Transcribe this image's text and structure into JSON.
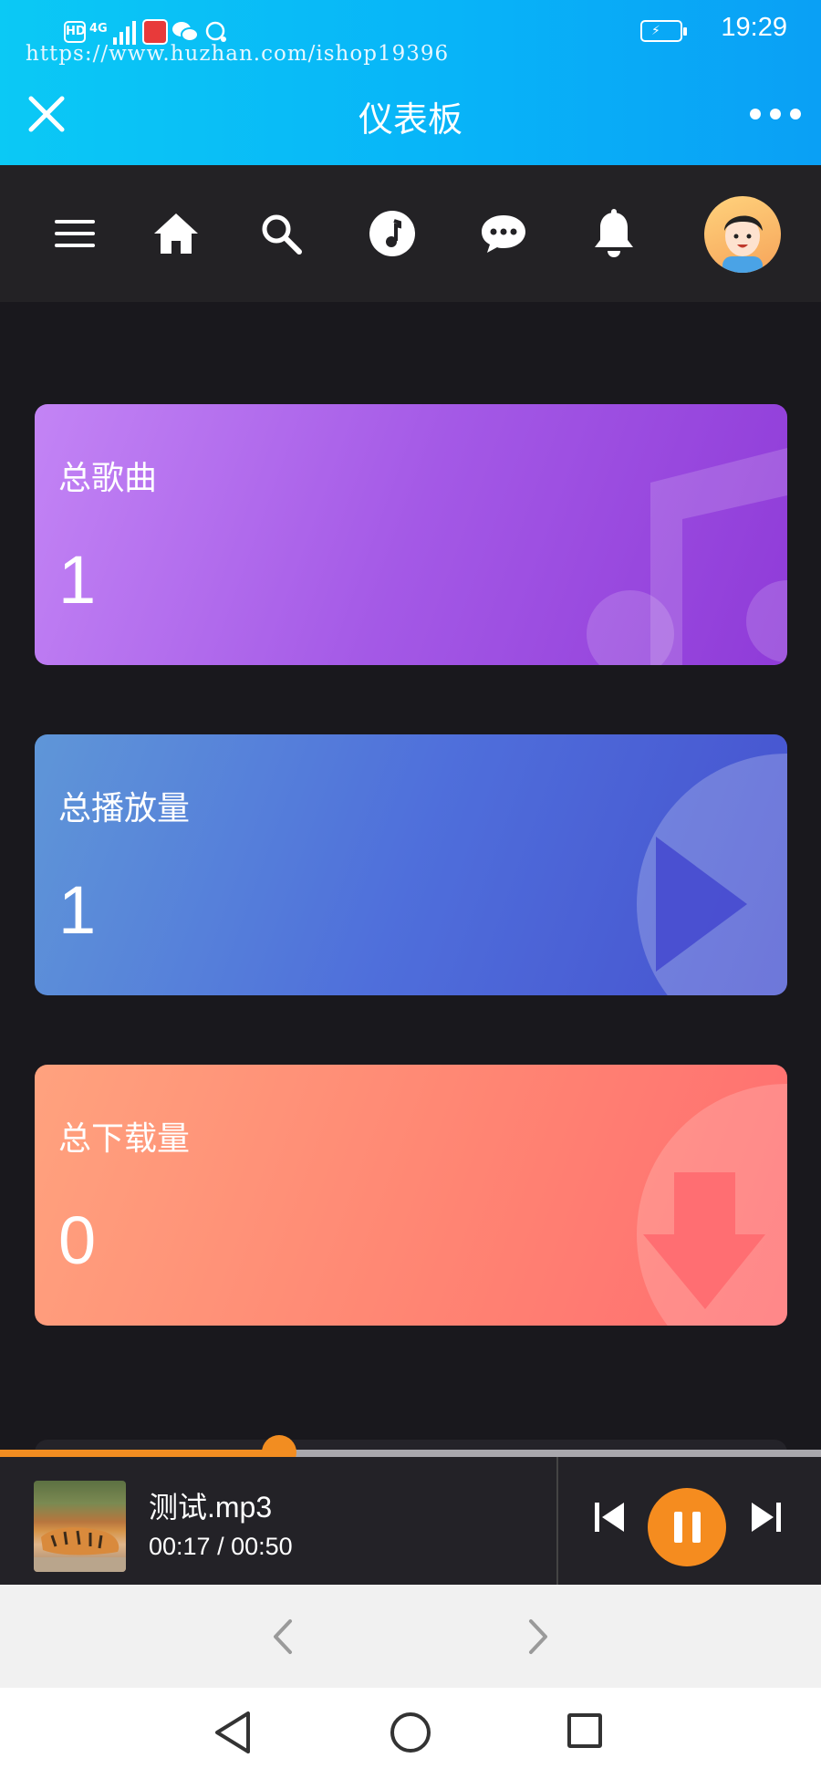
{
  "status_bar": {
    "hd": "HD",
    "network": "4G",
    "time": "19:29"
  },
  "url_overlay": "https://www.huzhan.com/ishop19396",
  "header": {
    "title": "仪表板"
  },
  "nav": {
    "items": [
      "menu-icon",
      "home-icon",
      "search-icon",
      "music-note-icon",
      "chat-icon",
      "bell-icon",
      "avatar"
    ]
  },
  "cards": [
    {
      "label": "总歌曲",
      "value": "1",
      "icon": "music-note-icon",
      "colors": [
        "#c384f5",
        "#8f3bd8"
      ]
    },
    {
      "label": "总播放量",
      "value": "1",
      "icon": "play-icon",
      "colors": [
        "#5f96d8",
        "#4651cf"
      ]
    },
    {
      "label": "总下载量",
      "value": "0",
      "icon": "download-arrow-icon",
      "colors": [
        "#ffa27e",
        "#ff6d70"
      ]
    }
  ],
  "player": {
    "track_name": "测试.mp3",
    "time_display": "00:17 / 00:50",
    "progress": 0.34,
    "accent_color": "#f28d21"
  },
  "colors": {
    "background": "#19181d",
    "header_gradient_start": "#0bc9f5",
    "header_gradient_end": "#0aa0f5"
  }
}
